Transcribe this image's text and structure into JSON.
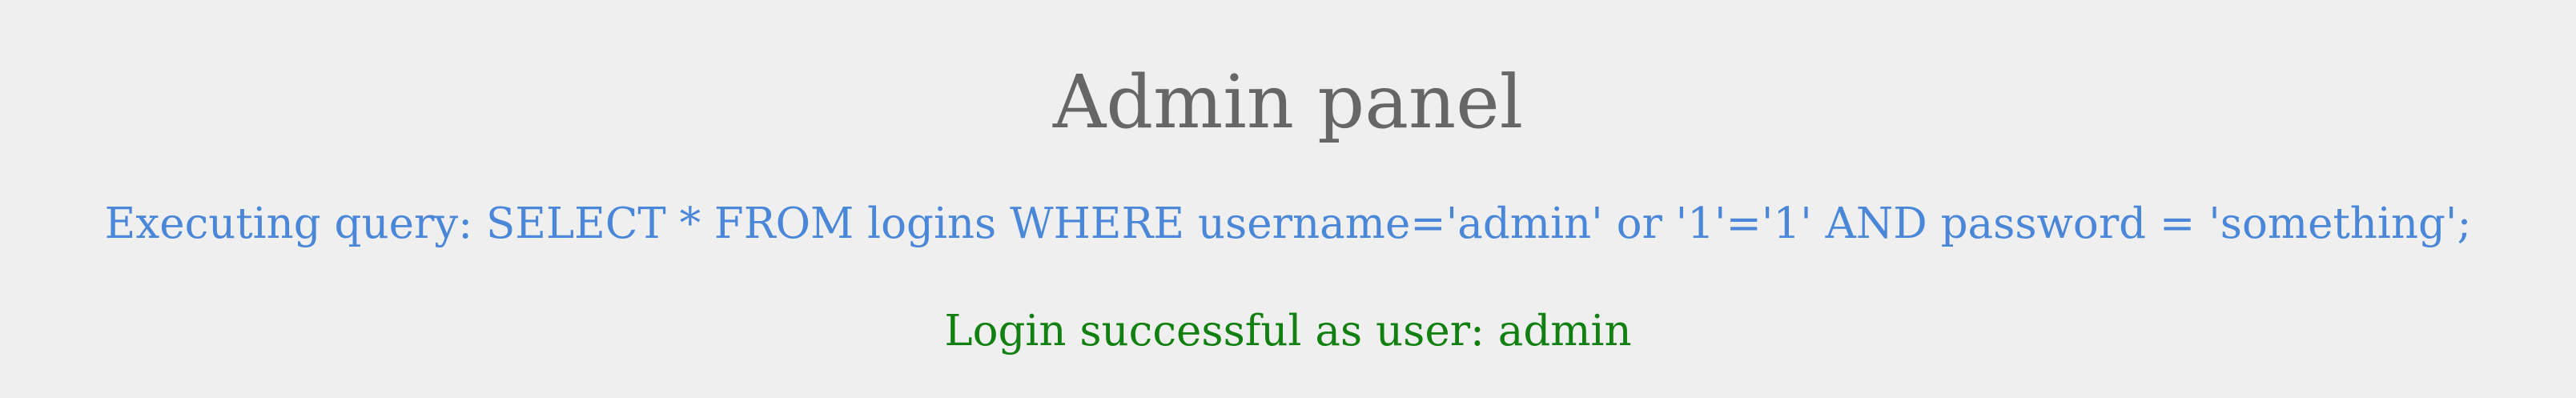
{
  "page": {
    "title": "Admin panel",
    "query_message": "Executing query: SELECT * FROM logins WHERE username='admin' or '1'='1' AND password = 'something';",
    "status_message": "Login successful as user: admin"
  },
  "colors": {
    "background": "#efefef",
    "title": "#666666",
    "query": "#4a87d8",
    "success": "#118011"
  }
}
